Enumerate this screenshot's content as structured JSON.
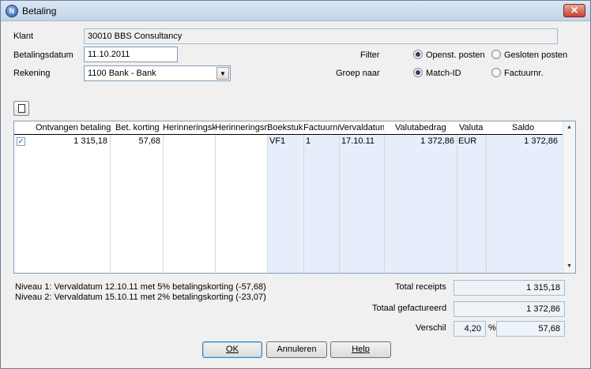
{
  "window": {
    "title": "Betaling",
    "close_label": "✕"
  },
  "form": {
    "klant_label": "Klant",
    "klant_value": "30010 BBS Consultancy",
    "datum_label": "Betalingsdatum",
    "datum_value": "11.10.2011",
    "rekening_label": "Rekening",
    "rekening_value": "1100 Bank - Bank",
    "filter_label": "Filter",
    "filter_options": [
      "Openst. posten",
      "Gesloten posten"
    ],
    "filter_selected": 0,
    "groep_label": "Groep naar",
    "groep_options": [
      "Match-ID",
      "Factuurnr."
    ],
    "groep_selected": 0
  },
  "grid": {
    "columns": [
      "Ontvangen betaling",
      "Bet. korting",
      "Herinneringsk",
      "Herinneringsre",
      "Boekstuk",
      "Factuurnr",
      "Vervaldatun",
      "Valutabedrag",
      "Valuta",
      "Saldo"
    ],
    "rows": [
      {
        "checked": true,
        "ontvangen": "1 315,18",
        "korting": "57,68",
        "herinneringsk": "",
        "herinneringsre": "",
        "boekstuk": "VF1",
        "factuurnr": "1",
        "vervaldatum": "17.10.11",
        "valutabedrag": "1 372,86",
        "valuta": "EUR",
        "saldo": "1 372,86"
      }
    ]
  },
  "info": {
    "niveau1": "Niveau 1: Vervaldatum 12.10.11 met 5% betalingskorting (-57,68)",
    "niveau2": "Niveau 2: Vervaldatum 15.10.11 met 2% betalingskorting (-23,07)"
  },
  "totals": {
    "receipts_label": "Total receipts",
    "receipts_value": "1 315,18",
    "gefactureerd_label": "Totaal gefactureerd",
    "gefactureerd_value": "1 372,86",
    "verschil_label": "Verschil",
    "verschil_percent": "4,20",
    "percent_sign": "%",
    "verschil_value": "57,68"
  },
  "buttons": {
    "ok": "OK",
    "annuleren": "Annuleren",
    "help": "Help"
  }
}
